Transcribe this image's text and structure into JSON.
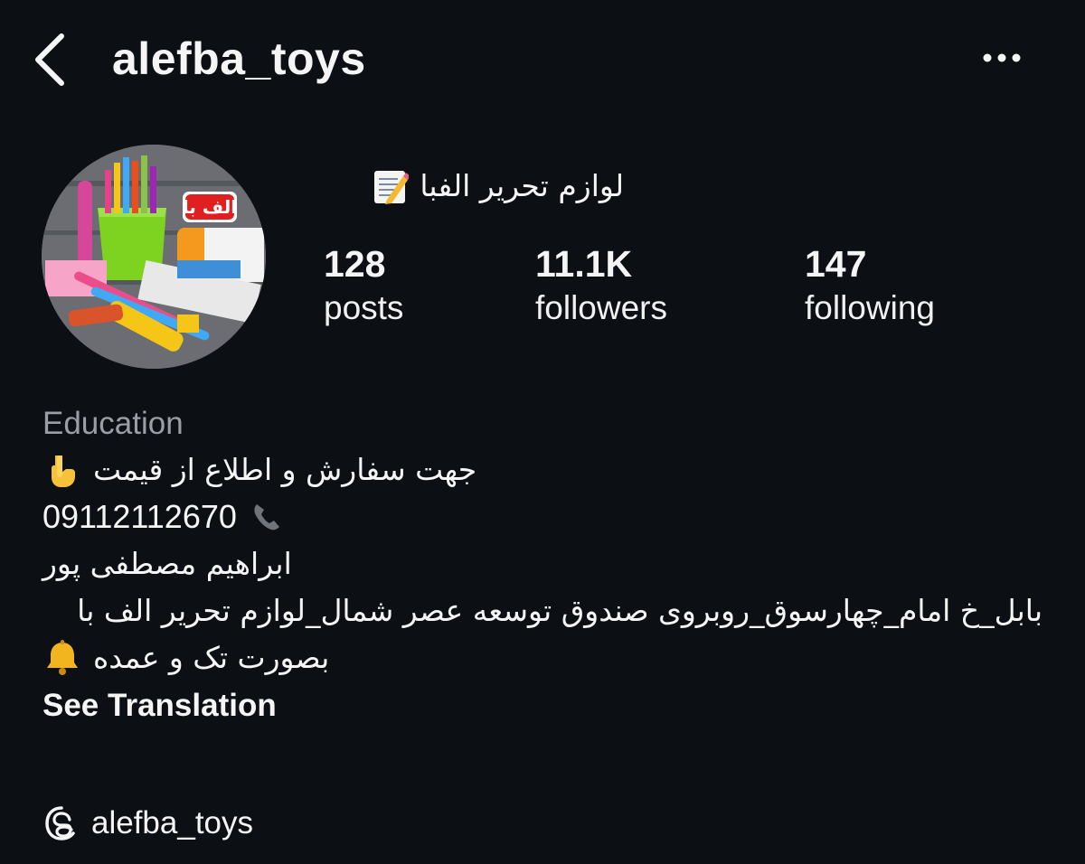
{
  "header": {
    "username": "alefba_toys"
  },
  "avatar": {
    "badge_text": "الف با"
  },
  "profile": {
    "display_name": "لوازم تحریر الفبا"
  },
  "stats": {
    "posts": {
      "value": "128",
      "label": "posts"
    },
    "followers": {
      "value": "11.1K",
      "label": "followers"
    },
    "following": {
      "value": "147",
      "label": "following"
    }
  },
  "bio": {
    "category": "Education",
    "line1": "جهت سفارش و اطلاع از قیمت",
    "phone": "09112112670",
    "owner": "ابراهیم مصطفی پور",
    "address": "بابل_خ امام_چهارسوق_روبروی صندوق توسعه عصر شمال_لوازم تحریر الف با",
    "sales": "بصورت تک و عمده",
    "see_translation": "See Translation"
  },
  "threads": {
    "handle": "alefba_toys"
  },
  "icons": {
    "back": "chevron-left-icon",
    "more": "more-horizontal-icon",
    "memo": "memo-icon",
    "point_down": "point-down-icon",
    "phone": "telephone-receiver-icon",
    "bell": "bell-icon",
    "threads": "threads-icon"
  }
}
